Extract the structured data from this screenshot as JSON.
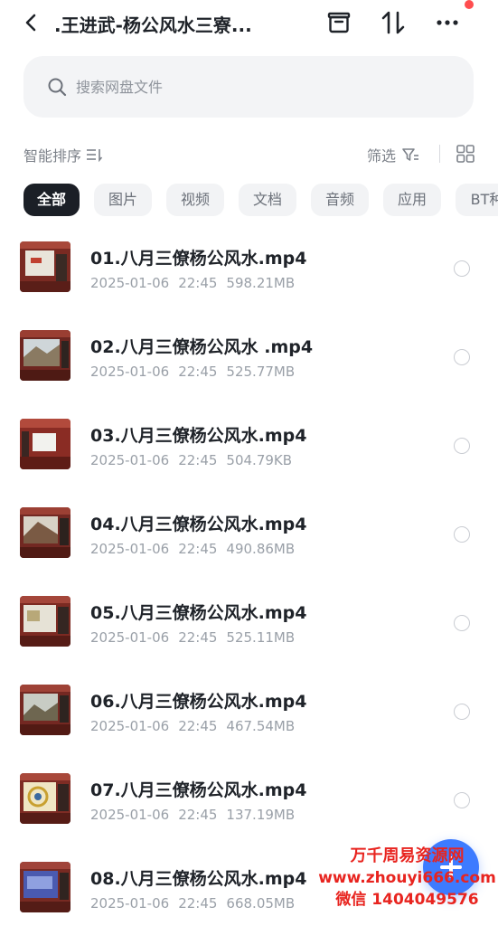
{
  "header": {
    "title": ".王进武-杨公风水三寮...",
    "back_icon": "back-arrow-icon",
    "archive_icon": "archive-box-icon",
    "sort_icon": "sort-arrows-icon",
    "more_icon": "more-dots-icon"
  },
  "search": {
    "placeholder": "搜索网盘文件"
  },
  "toolbar": {
    "sort_label": "智能排序",
    "filter_label": "筛选"
  },
  "tabs": [
    {
      "label": "全部",
      "active": true
    },
    {
      "label": "图片",
      "active": false
    },
    {
      "label": "视频",
      "active": false
    },
    {
      "label": "文档",
      "active": false
    },
    {
      "label": "音频",
      "active": false
    },
    {
      "label": "应用",
      "active": false
    },
    {
      "label": "BT种",
      "active": false
    }
  ],
  "files": [
    {
      "name": "01.八月三僚杨公风水.mp4",
      "date": "2025-01-06",
      "time": "22:45",
      "size": "598.21MB"
    },
    {
      "name": "02.八月三僚杨公风水 .mp4",
      "date": "2025-01-06",
      "time": "22:45",
      "size": "525.77MB"
    },
    {
      "name": "03.八月三僚杨公风水.mp4",
      "date": "2025-01-06",
      "time": "22:45",
      "size": "504.79KB"
    },
    {
      "name": "04.八月三僚杨公风水.mp4",
      "date": "2025-01-06",
      "time": "22:45",
      "size": "490.86MB"
    },
    {
      "name": "05.八月三僚杨公风水.mp4",
      "date": "2025-01-06",
      "time": "22:45",
      "size": "525.11MB"
    },
    {
      "name": "06.八月三僚杨公风水.mp4",
      "date": "2025-01-06",
      "time": "22:45",
      "size": "467.54MB"
    },
    {
      "name": "07.八月三僚杨公风水.mp4",
      "date": "2025-01-06",
      "time": "22:45",
      "size": "137.19MB"
    },
    {
      "name": "08.八月三僚杨公风水.mp4",
      "date": "2025-01-06",
      "time": "22:45",
      "size": "668.05MB"
    }
  ],
  "watermark": {
    "line1": "万千周易资源网",
    "line2": "www.zhouyi666.com",
    "line3": "微信 1404049576"
  },
  "colors": {
    "accent": "#3d7bff",
    "active_chip": "#1b1f26",
    "watermark": "#e8241f",
    "notification": "#ff4d4f"
  }
}
